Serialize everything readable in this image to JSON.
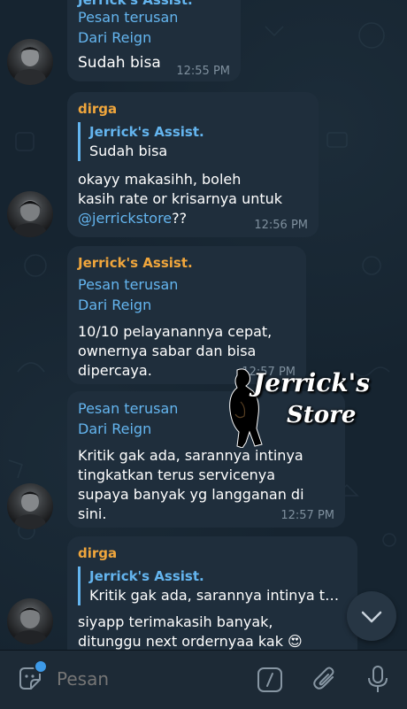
{
  "messages": [
    {
      "sender": "Jerrick's Assist.",
      "forward_line1": "Pesan terusan",
      "forward_line2": "Dari  Reign",
      "text": "Sudah bisa",
      "time": "12:55 PM"
    },
    {
      "sender": "dirga",
      "reply_name": "Jerrick's Assist.",
      "reply_text": "Sudah bisa",
      "text_line1": "okayy makasihh, boleh",
      "text_line2": "kasih rate or krisarnya untuk",
      "mention": "@jerrickstore",
      "after_mention": "??",
      "time": "12:56 PM"
    },
    {
      "sender": "Jerrick's Assist.",
      "forward_line1": "Pesan terusan",
      "forward_line2": "Dari  Reign",
      "text_line1": "10/10 pelayanannya cepat,",
      "text_line2": "ownernya sabar dan bisa",
      "text_line3": "dipercaya.",
      "time": "12:57 PM"
    },
    {
      "forward_line1": "Pesan terusan",
      "forward_line2": "Dari  Reign",
      "text_line1": "Kritik gak ada, sarannya intinya",
      "text_line2": "tingkatkan terus servicenya",
      "text_line3": "supaya banyak yg langganan di",
      "text_line4": "sini.",
      "time": "12:57 PM"
    },
    {
      "sender": "dirga",
      "reply_name": "Jerrick's Assist.",
      "reply_text": "Kritik gak ada, sarannya intinya t…",
      "text_line1": "siyapp terimakasih banyak,",
      "text_line2": "ditunggu next ordernyaa kak 😍"
    }
  ],
  "watermark": {
    "line1": "Jerrick's",
    "line2": "Store"
  },
  "input": {
    "placeholder": "Pesan"
  },
  "icons": {
    "sticker": "sticker-icon",
    "command": "command-icon",
    "attach": "paperclip-icon",
    "mic": "microphone-icon",
    "scroll": "chevron-down-icon"
  },
  "colors": {
    "accent": "#64b5ef",
    "sender_name": "#f0a63c",
    "bubble": "#1f2e3c",
    "unread_dot": "#3d9ae8"
  }
}
